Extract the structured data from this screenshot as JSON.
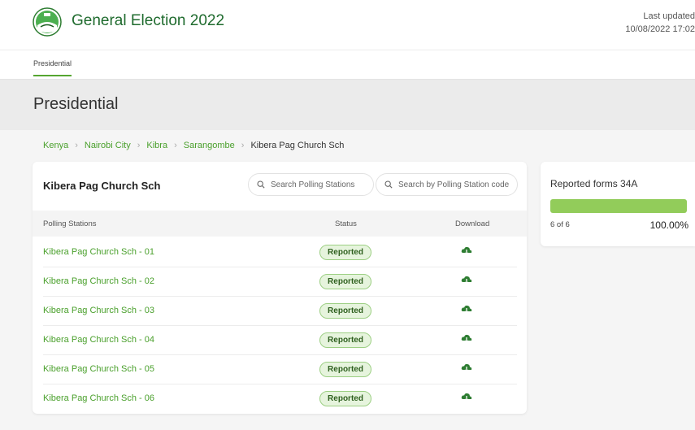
{
  "header": {
    "title": "General Election 2022",
    "last_updated_label": "Last updated",
    "last_updated_value": "10/08/2022 17:02"
  },
  "tabs": [
    {
      "label": "Presidential",
      "active": true
    }
  ],
  "page_title": "Presidential",
  "breadcrumb": [
    "Kenya",
    "Nairobi City",
    "Kibra",
    "Sarangombe",
    "Kibera Pag Church Sch"
  ],
  "card": {
    "title": "Kibera Pag Church Sch",
    "search_stations_placeholder": "Search Polling Stations",
    "search_code_placeholder": "Search by Polling Station code",
    "columns": [
      "Polling Stations",
      "Status",
      "Download"
    ],
    "rows": [
      {
        "name": "Kibera Pag Church Sch - 01",
        "status": "Reported",
        "icon": "download-cloud-icon"
      },
      {
        "name": "Kibera Pag Church Sch - 02",
        "status": "Reported",
        "icon": "download-cloud-icon"
      },
      {
        "name": "Kibera Pag Church Sch - 03",
        "status": "Reported",
        "icon": "download-cloud-icon"
      },
      {
        "name": "Kibera Pag Church Sch - 04",
        "status": "Reported",
        "icon": "download-cloud-icon"
      },
      {
        "name": "Kibera Pag Church Sch - 05",
        "status": "Reported",
        "icon": "download-cloud-icon"
      },
      {
        "name": "Kibera Pag Church Sch - 06",
        "status": "Reported",
        "icon": "download-cloud-icon"
      }
    ]
  },
  "summary": {
    "title": "Reported forms 34A",
    "count": "6 of 6",
    "percent": "100.00%",
    "progress": 1.0
  },
  "colors": {
    "brand_green": "#1f6b2e",
    "link_green": "#4aa02c",
    "progress_green": "#92cc5a",
    "badge_bg": "#e6f4dd"
  }
}
